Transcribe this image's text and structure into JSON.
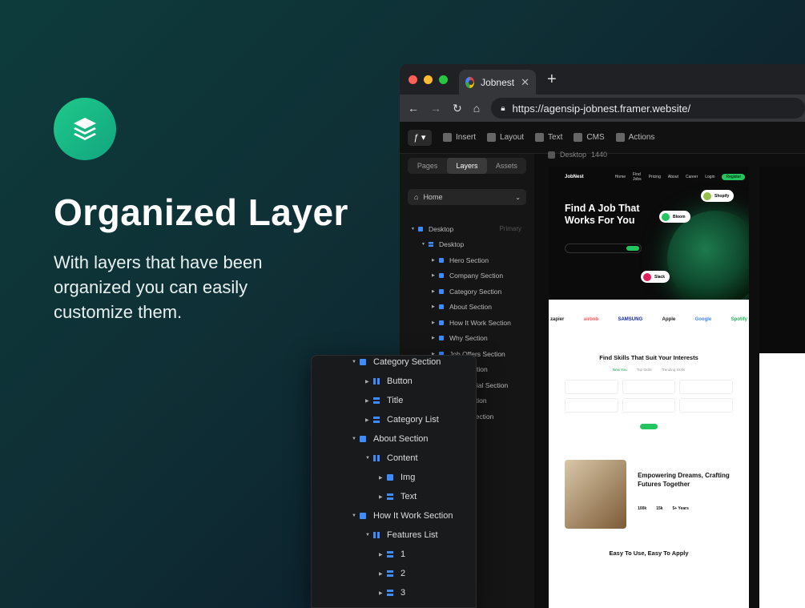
{
  "marketing": {
    "headline": "Organized Layer",
    "subtext": "With layers that have been organized you can easily customize them."
  },
  "browser": {
    "tab_title": "Jobnest",
    "url": "https://agensip-jobnest.framer.website/"
  },
  "toolbar": {
    "items": [
      "Insert",
      "Layout",
      "Text",
      "CMS",
      "Actions"
    ]
  },
  "panel": {
    "segments": [
      "Pages",
      "Layers",
      "Assets"
    ],
    "active_segment": "Layers",
    "page_select": "Home",
    "primary_label": "Primary",
    "tree": [
      {
        "label": "Desktop",
        "depth": 0,
        "icon": "square"
      },
      {
        "label": "Desktop",
        "depth": 1,
        "icon": "bars"
      },
      {
        "label": "Hero Section",
        "depth": 2,
        "icon": "square"
      },
      {
        "label": "Company Section",
        "depth": 2,
        "icon": "square"
      },
      {
        "label": "Category Section",
        "depth": 2,
        "icon": "square"
      },
      {
        "label": "About Section",
        "depth": 2,
        "icon": "square"
      },
      {
        "label": "How It Work Section",
        "depth": 2,
        "icon": "square"
      },
      {
        "label": "Why Section",
        "depth": 2,
        "icon": "square"
      },
      {
        "label": "Job Offers Section",
        "depth": 2,
        "icon": "square"
      },
      {
        "label": "FAQ Section",
        "depth": 2,
        "icon": "square"
      },
      {
        "label": "Testimonial Section",
        "depth": 2,
        "icon": "square"
      },
      {
        "label": "CTA Section",
        "depth": 2,
        "icon": "square"
      },
      {
        "label": "Footer Section",
        "depth": 2,
        "icon": "square"
      }
    ]
  },
  "canvas": {
    "frame_label": "Desktop",
    "frame_width": "1440",
    "site": {
      "brand": "JobNest",
      "nav": [
        "Home",
        "Find Jobs",
        "Pricing",
        "About",
        "Career"
      ],
      "login": "Login",
      "register": "Register",
      "hero_title": "Find A Job That Works For You",
      "chips": [
        "Shopify",
        "Bloom",
        "Slack"
      ],
      "logos": [
        "zapier",
        "airbnb",
        "SAMSUNG",
        "Apple",
        "Google",
        "Spotify"
      ],
      "skills_title": "Find Skills That Suit Your Interests",
      "skill_tabs": [
        "New You",
        "Top Skills",
        "Trending Skills"
      ],
      "emp_title": "Empowering Dreams, Crafting Futures Together",
      "stats": [
        "100k",
        "15k",
        "5+ Years"
      ],
      "bottom_title": "Easy To Use, Easy To Apply"
    }
  },
  "float_panel": {
    "rows": [
      {
        "label": "Category Section",
        "depth": 0,
        "icon": "square"
      },
      {
        "label": "Button",
        "depth": 1,
        "icon": "cols"
      },
      {
        "label": "Title",
        "depth": 1,
        "icon": "bars"
      },
      {
        "label": "Category List",
        "depth": 1,
        "icon": "bars"
      },
      {
        "label": "About Section",
        "depth": 0,
        "icon": "square"
      },
      {
        "label": "Content",
        "depth": 1,
        "icon": "cols"
      },
      {
        "label": "Img",
        "depth": 2,
        "icon": "square"
      },
      {
        "label": "Text",
        "depth": 2,
        "icon": "bars"
      },
      {
        "label": "How It Work Section",
        "depth": 0,
        "icon": "square"
      },
      {
        "label": "Features List",
        "depth": 1,
        "icon": "cols"
      },
      {
        "label": "1",
        "depth": 2,
        "icon": "bars"
      },
      {
        "label": "2",
        "depth": 2,
        "icon": "bars"
      },
      {
        "label": "3",
        "depth": 2,
        "icon": "bars"
      }
    ]
  },
  "colors": {
    "accent_green": "#22c55e",
    "layer_blue": "#3d8bfd"
  }
}
